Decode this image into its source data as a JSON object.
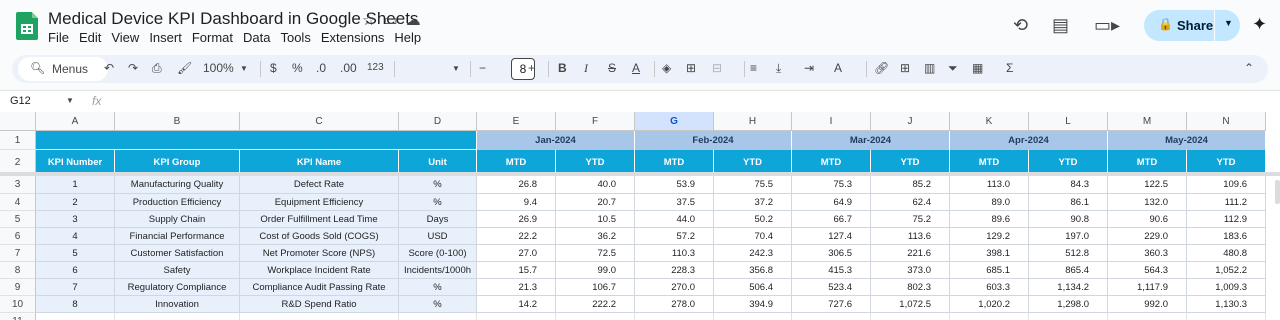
{
  "app": {
    "title": "Medical Device KPI Dashboard in Google Sheets",
    "menus": [
      "File",
      "Edit",
      "View",
      "Insert",
      "Format",
      "Data",
      "Tools",
      "Extensions",
      "Help"
    ],
    "share_label": "Share"
  },
  "toolbar": {
    "menus_label": "Menus",
    "zoom": "100%",
    "currency": "$",
    "percent": "%",
    "dec_decrease": ".0",
    "dec_increase": ".00",
    "number_format": "123",
    "font_size": "8",
    "minus": "−",
    "plus": "+",
    "bold": "B",
    "italic": "I"
  },
  "formula_bar": {
    "cell_ref": "G12",
    "fx": "fx",
    "formula": ""
  },
  "sheet": {
    "columns": [
      "A",
      "B",
      "C",
      "D",
      "E",
      "F",
      "G",
      "H",
      "I",
      "J",
      "K",
      "L",
      "M",
      "N"
    ],
    "selected_column": "G",
    "rows_numbers": [
      "1",
      "2",
      "3",
      "4",
      "5",
      "6",
      "7",
      "8",
      "9",
      "10",
      "11"
    ],
    "months": [
      "Jan-2024",
      "Feb-2024",
      "Mar-2024",
      "Apr-2024",
      "May-2024"
    ],
    "header": [
      "KPI Number",
      "KPI Group",
      "KPI Name",
      "Unit"
    ],
    "subheader": [
      "MTD",
      "YTD",
      "MTD",
      "YTD",
      "MTD",
      "YTD",
      "MTD",
      "YTD",
      "MTD",
      "YTD"
    ],
    "rows": [
      [
        "1",
        "Manufacturing Quality",
        "Defect Rate",
        "%",
        "26.8",
        "40.0",
        "53.9",
        "75.5",
        "75.3",
        "85.2",
        "113.0",
        "84.3",
        "122.5",
        "109.6"
      ],
      [
        "2",
        "Production Efficiency",
        "Equipment Efficiency",
        "%",
        "9.4",
        "20.7",
        "37.5",
        "37.2",
        "64.9",
        "62.4",
        "89.0",
        "86.1",
        "132.0",
        "111.2"
      ],
      [
        "3",
        "Supply Chain",
        "Order Fulfillment Lead Time",
        "Days",
        "26.9",
        "10.5",
        "44.0",
        "50.2",
        "66.7",
        "75.2",
        "89.6",
        "90.8",
        "90.6",
        "112.9"
      ],
      [
        "4",
        "Financial Performance",
        "Cost of Goods Sold (COGS)",
        "USD",
        "22.2",
        "36.2",
        "57.2",
        "70.4",
        "127.4",
        "113.6",
        "129.2",
        "197.0",
        "229.0",
        "183.6"
      ],
      [
        "5",
        "Customer Satisfaction",
        "Net Promoter Score (NPS)",
        "Score (0-100)",
        "27.0",
        "72.5",
        "110.3",
        "242.3",
        "306.5",
        "221.6",
        "398.1",
        "512.8",
        "360.3",
        "480.8"
      ],
      [
        "6",
        "Safety",
        "Workplace Incident Rate",
        "Incidents/1000h",
        "15.7",
        "99.0",
        "228.3",
        "356.8",
        "415.3",
        "373.0",
        "685.1",
        "865.4",
        "564.3",
        "1,052.2"
      ],
      [
        "7",
        "Regulatory Compliance",
        "Compliance Audit Passing Rate",
        "%",
        "21.3",
        "106.7",
        "270.0",
        "506.4",
        "523.4",
        "802.3",
        "603.3",
        "1,134.2",
        "1,117.9",
        "1,009.3"
      ],
      [
        "8",
        "Innovation",
        "R&D Spend Ratio",
        "%",
        "14.2",
        "222.2",
        "278.0",
        "394.9",
        "727.6",
        "1,072.5",
        "1,020.2",
        "1,298.0",
        "992.0",
        "1,130.3"
      ]
    ]
  },
  "colors": {
    "header_blue": "#0ea5d8",
    "month_band": "#a8c6e8",
    "left_cells": "#e8f0fb",
    "grid": "#d0d7de"
  }
}
